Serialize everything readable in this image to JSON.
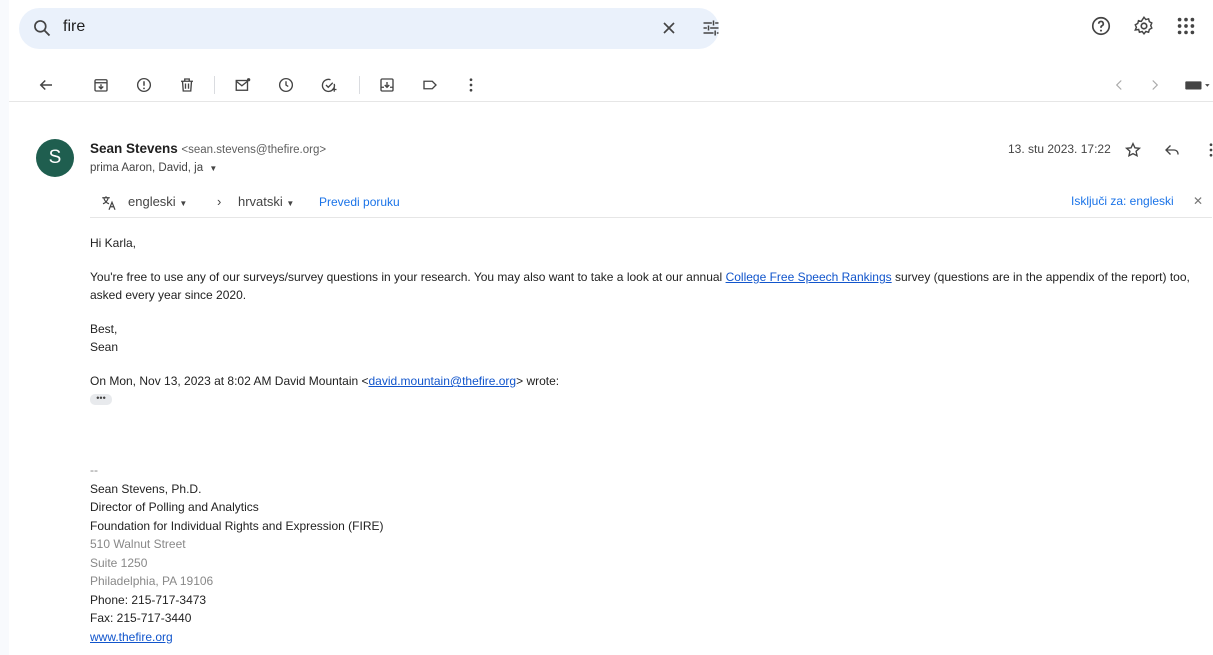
{
  "search": {
    "value": "fire"
  },
  "email": {
    "sender_name": "Sean Stevens",
    "sender_email": "<sean.stevens@thefire.org>",
    "recipients": "prima Aaron, David, ja",
    "date": "13. stu 2023. 17:22",
    "avatar_letter": "S",
    "avatar_color": "#1f5e4f"
  },
  "translate": {
    "from_lang": "engleski",
    "to_lang": "hrvatski",
    "translate_link": "Prevedi poruku",
    "turn_off": "Isključi za: engleski"
  },
  "body": {
    "greeting": "Hi Karla,",
    "para1_before": "You're free to use any of our surveys/survey questions in your research. You may also want to take a look at our annual ",
    "para1_link": "College Free Speech Rankings",
    "para1_after": " survey (questions are in the appendix of the report) too, asked every year since 2020.",
    "closing1": "Best,",
    "closing2": "Sean",
    "quote_before": "On Mon, Nov 13, 2023 at 8:02 AM David Mountain <",
    "quote_email": "david.mountain@thefire.org",
    "quote_after": "> wrote:",
    "dots": "•••"
  },
  "signature": {
    "dash": "--",
    "name": "Sean Stevens, Ph.D.",
    "title": "Director of Polling and Analytics",
    "org": "Foundation for Individual Rights and Expression (FIRE)",
    "street": "510 Walnut Street",
    "suite": "Suite 1250",
    "city": "Philadelphia, PA 19106",
    "phone": "Phone: 215-717-3473",
    "fax": "Fax: 215-717-3440",
    "website": "www.thefire.org"
  }
}
